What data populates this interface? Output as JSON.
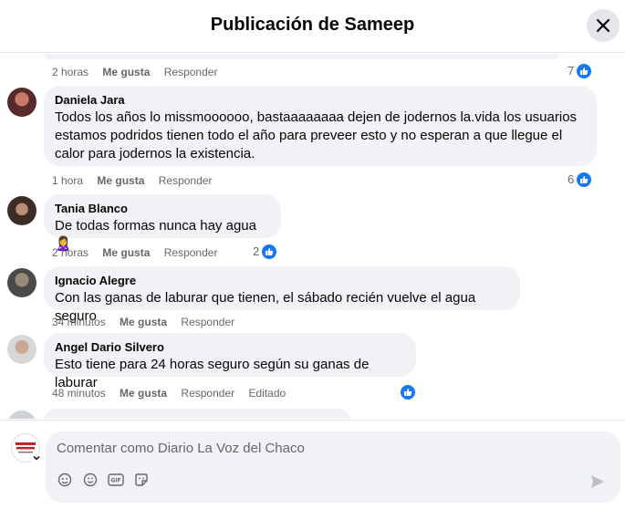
{
  "header": {
    "title": "Publicación de Sameep"
  },
  "comments": [
    {
      "author": "",
      "text": "",
      "time": "2 horas",
      "like_label": "Me gusta",
      "reply_label": "Responder",
      "extra": "",
      "likes": "7"
    },
    {
      "author": "Daniela Jara",
      "text": "Todos los años lo missmoooooo, bastaaaaaaaa dejen de jodernos la.vida los usuarios estamos podridos tienen todo el año para preveer esto y no esperan a que llegue el calor para jodernos la existencia.",
      "time": "1 hora",
      "like_label": "Me gusta",
      "reply_label": "Responder",
      "extra": "",
      "likes": "6"
    },
    {
      "author": "Tania Blanco",
      "text": "De todas formas nunca hay agua 🙎‍♀️",
      "time": "2 horas",
      "like_label": "Me gusta",
      "reply_label": "Responder",
      "extra": "",
      "likes": "2"
    },
    {
      "author": "Ignacio Alegre",
      "text": "Con las ganas de laburar que tienen, el sábado recién vuelve el agua seguro",
      "time": "34 minutos",
      "like_label": "Me gusta",
      "reply_label": "Responder",
      "extra": "",
      "likes": ""
    },
    {
      "author": "Angel Dario Silvero",
      "text": "Esto tiene para 24 horas seguro según su ganas de laburar",
      "time": "48 minutos",
      "like_label": "Me gusta",
      "reply_label": "Responder",
      "extra": "Editado",
      "likes": ""
    }
  ],
  "composer": {
    "placeholder": "Comentar como Diario La Voz del Chaco",
    "avatar_text": "LA VOZ DEL CHACO"
  }
}
